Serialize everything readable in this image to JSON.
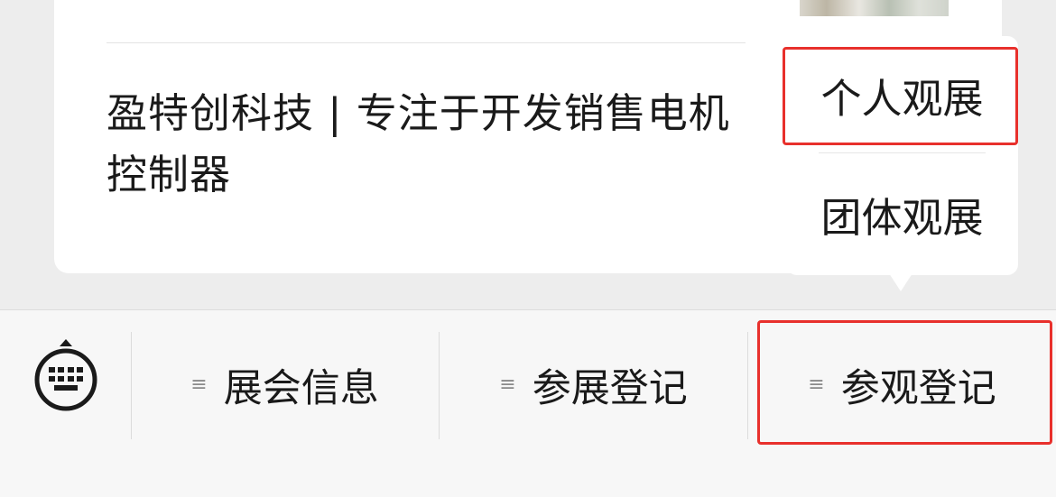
{
  "article": {
    "title": "盈特创科技 | 专注于开发销售电机控制器"
  },
  "popup_menu": {
    "items": [
      "个人观展",
      "团体观展"
    ]
  },
  "bottom_menu": {
    "items": [
      {
        "icon": "list-icon",
        "glyph": "≡",
        "label": "展会信息"
      },
      {
        "icon": "list-icon",
        "glyph": "≡",
        "label": "参展登记"
      },
      {
        "icon": "list-icon",
        "glyph": "≡",
        "label": "参观登记"
      }
    ],
    "keyboard_icon": "keyboard-icon"
  },
  "colors": {
    "highlight": "#e8302c",
    "page_bg": "#ededed",
    "menubar_bg": "#f7f7f7"
  }
}
